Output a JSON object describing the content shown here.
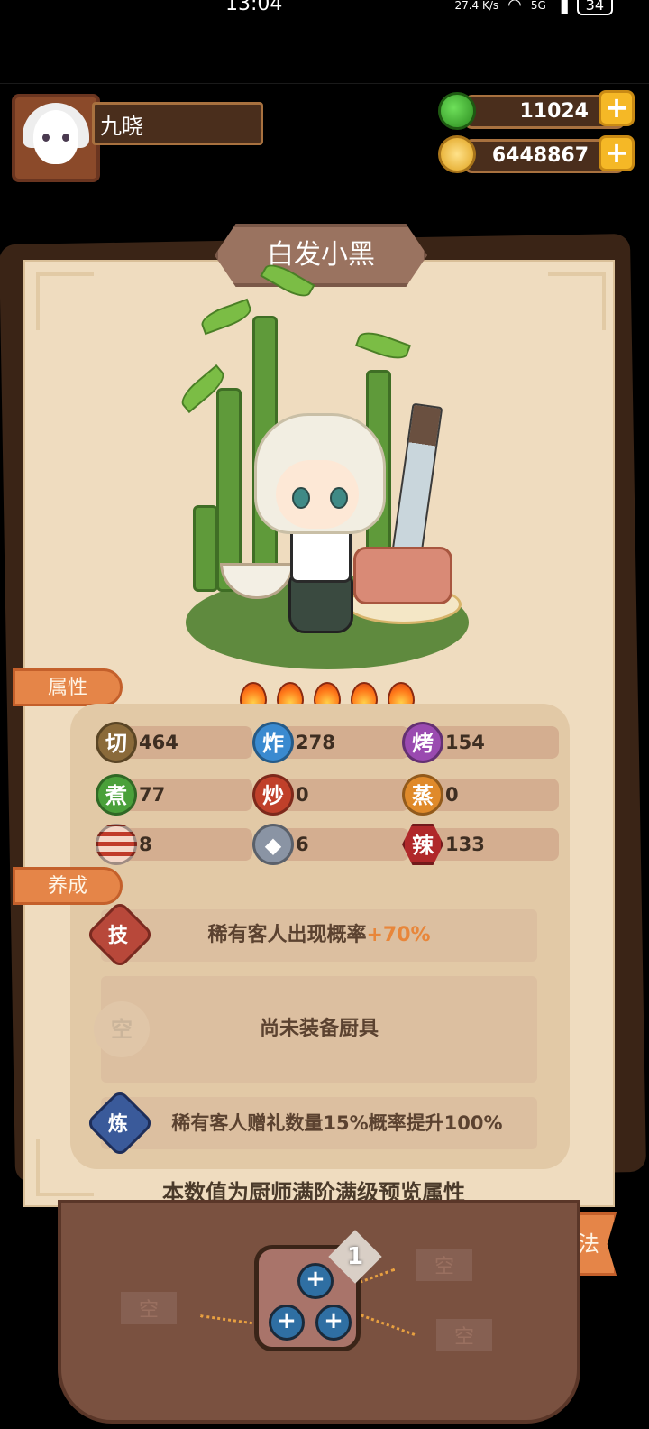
{
  "status_bar": {
    "time": "13:04",
    "net_speed": "27.4 K/s",
    "network": "5G",
    "battery": "34"
  },
  "player": {
    "name": "九晓"
  },
  "resources": {
    "jade": "11024",
    "coins": "6448867",
    "add_label": "+"
  },
  "chef": {
    "name": "白发小黑",
    "stars": 5
  },
  "tabs": {
    "attributes": "属性",
    "cultivation": "养成",
    "xinfa": "心法"
  },
  "stats": [
    {
      "icon": "切",
      "value": "464",
      "color": "#8a6a3a"
    },
    {
      "icon": "炸",
      "value": "278",
      "color": "#3a8ad0"
    },
    {
      "icon": "烤",
      "value": "154",
      "color": "#9a4ab0"
    },
    {
      "icon": "煮",
      "value": "77",
      "color": "#4aa03a"
    },
    {
      "icon": "炒",
      "value": "0",
      "color": "#c0402a"
    },
    {
      "icon": "蒸",
      "value": "0",
      "color": "#e08a2a"
    },
    {
      "icon": "meat-icon",
      "value": "8",
      "color": "#c03a2a"
    },
    {
      "icon": "fish-icon",
      "value": "6",
      "color": "#8a94a4"
    },
    {
      "icon": "辣",
      "value": "133",
      "color": "#b0282a"
    }
  ],
  "skills": {
    "skill_icon": "技",
    "skill_text": "稀有客人出现概率",
    "skill_bonus": "+70%",
    "equip_icon": "空",
    "equip_text": "尚未装备厨具",
    "refine_icon": "炼",
    "refine_text": "稀有客人赠礼数量15%概率提升100%"
  },
  "footer_note": "本数值为厨师满阶满级预览属性",
  "tree": {
    "level": "1",
    "empty": "空"
  },
  "colors": {
    "accent": "#e58548",
    "card": "#efdcbf",
    "bonus": "#e8863a"
  }
}
